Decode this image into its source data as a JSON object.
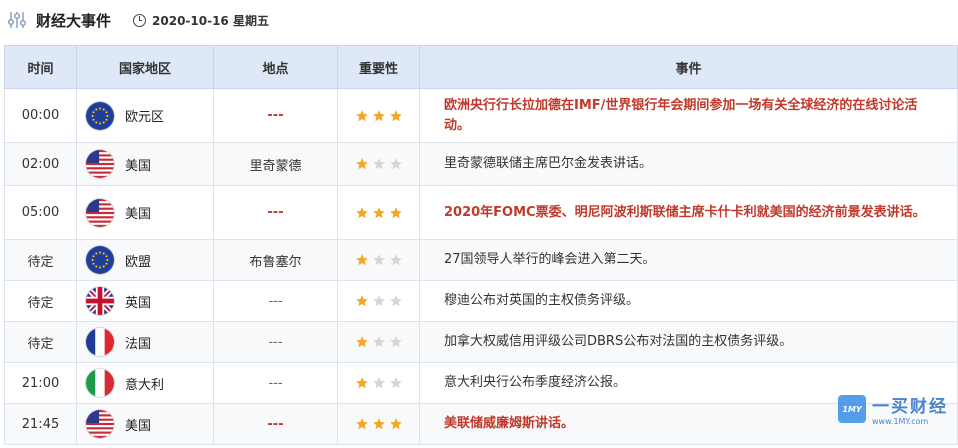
{
  "header": {
    "title": "财经大事件",
    "date": "2020-10-16 星期五"
  },
  "columns": [
    "时间",
    "国家地区",
    "地点",
    "重要性",
    "事件"
  ],
  "rows": [
    {
      "time": "00:00",
      "flag": "eu",
      "country": "欧元区",
      "location": "---",
      "importance": 3,
      "event": "欧洲央行行长拉加德在IMF/世界银行年会期间参加一场有关全球经济的在线讨论活动。"
    },
    {
      "time": "02:00",
      "flag": "us",
      "country": "美国",
      "location": "里奇蒙德",
      "importance": 1,
      "event": "里奇蒙德联储主席巴尔金发表讲话。"
    },
    {
      "time": "05:00",
      "flag": "us",
      "country": "美国",
      "location": "---",
      "importance": 3,
      "event": "2020年FOMC票委、明尼阿波利斯联储主席卡什卡利就美国的经济前景发表讲话。"
    },
    {
      "time": "待定",
      "flag": "eu",
      "country": "欧盟",
      "location": "布鲁塞尔",
      "importance": 1,
      "event": "27国领导人举行的峰会进入第二天。"
    },
    {
      "time": "待定",
      "flag": "uk",
      "country": "英国",
      "location": "---",
      "importance": 1,
      "event": "穆迪公布对英国的主权债务评级。"
    },
    {
      "time": "待定",
      "flag": "fr",
      "country": "法国",
      "location": "---",
      "importance": 1,
      "event": "加拿大权威信用评级公司DBRS公布对法国的主权债务评级。"
    },
    {
      "time": "21:00",
      "flag": "it",
      "country": "意大利",
      "location": "---",
      "importance": 1,
      "event": "意大利央行公布季度经济公报。"
    },
    {
      "time": "21:45",
      "flag": "us",
      "country": "美国",
      "location": "---",
      "importance": 3,
      "event": "美联储威廉姆斯讲话。"
    }
  ],
  "colors": {
    "header_bg": "#dfe8f7",
    "highlight": "#c0392b",
    "star_on": "#f5a623",
    "star_off": "#d6d6d6"
  },
  "watermark": {
    "logo": "1MY",
    "name": "一买财经",
    "url": "www.1MY.com"
  }
}
